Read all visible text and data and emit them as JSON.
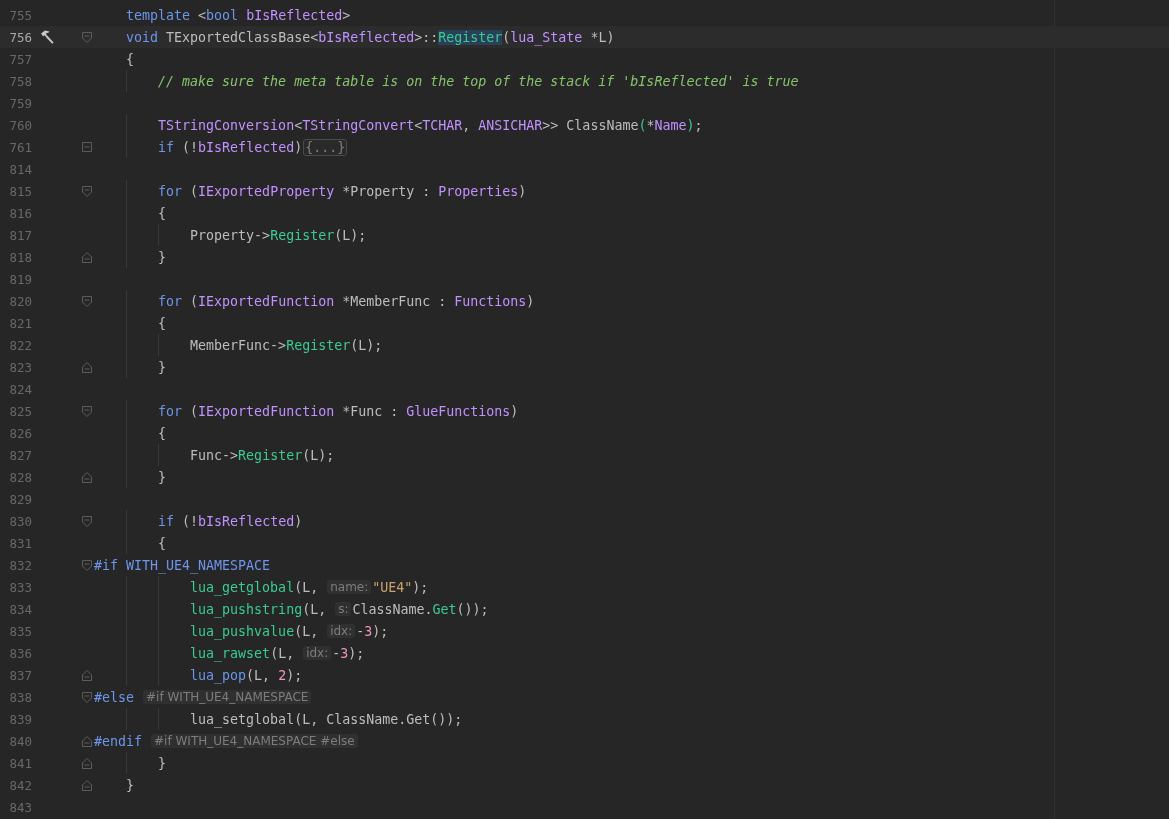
{
  "editor": {
    "lines": [
      {
        "number": "755",
        "current": false,
        "segments": [
          {
            "kind": "keyword",
            "text": "    template"
          },
          {
            "kind": "plain",
            "text": " <"
          },
          {
            "kind": "keyword",
            "text": "bool "
          },
          {
            "kind": "type",
            "text": "bIsReflected"
          },
          {
            "kind": "plain",
            "text": ">"
          }
        ]
      },
      {
        "number": "756",
        "current": true,
        "markers": [
          {
            "kind": "hammer"
          },
          {
            "kind": "fold-start"
          }
        ],
        "segments": [
          {
            "kind": "keyword",
            "text": "    void"
          },
          {
            "kind": "plain",
            "text": " TExportedClassBase<"
          },
          {
            "kind": "type",
            "text": "bIsReflected"
          },
          {
            "kind": "plain",
            "text": ">::"
          },
          {
            "kind": "usage",
            "text": "Register"
          },
          {
            "kind": "plain",
            "text": "("
          },
          {
            "kind": "type",
            "text": "lua_State"
          },
          {
            "kind": "plain",
            "text": " *L)"
          }
        ]
      },
      {
        "number": "757",
        "current": false,
        "segments": [
          {
            "kind": "plain",
            "text": "    {"
          }
        ]
      },
      {
        "number": "758",
        "current": false,
        "segments": [
          {
            "kind": "comment",
            "text": "        // make sure the meta table is on the top of the stack if 'bIsReflected' is true"
          }
        ]
      },
      {
        "number": "759",
        "current": false
      },
      {
        "number": "760",
        "current": false,
        "segments": [
          {
            "kind": "type",
            "text": "        TStringConversion"
          },
          {
            "kind": "plain",
            "text": "<"
          },
          {
            "kind": "type",
            "text": "TStringConvert"
          },
          {
            "kind": "plain",
            "text": "<"
          },
          {
            "kind": "type",
            "text": "TCHAR"
          },
          {
            "kind": "plain",
            "text": ", "
          },
          {
            "kind": "type",
            "text": "ANSICHAR"
          },
          {
            "kind": "plain",
            "text": ">> ClassName"
          },
          {
            "kind": "func",
            "text": "("
          },
          {
            "kind": "plain",
            "text": "*"
          },
          {
            "kind": "type",
            "text": "Name"
          },
          {
            "kind": "func",
            "text": ")"
          },
          {
            "kind": "plain",
            "text": ";"
          }
        ]
      },
      {
        "number": "761",
        "current": false,
        "markers": [
          {
            "kind": "collapsed"
          }
        ],
        "segments": [
          {
            "kind": "keyword",
            "text": "        if"
          },
          {
            "kind": "plain",
            "text": " (!"
          },
          {
            "kind": "type",
            "text": "bIsReflected"
          },
          {
            "kind": "plain",
            "text": ")"
          },
          {
            "kind": "folded",
            "text": "{...}"
          }
        ]
      },
      {
        "number": "814",
        "current": false
      },
      {
        "number": "815",
        "current": false,
        "markers": [
          {
            "kind": "fold-start"
          }
        ],
        "segments": [
          {
            "kind": "keyword",
            "text": "        for"
          },
          {
            "kind": "plain",
            "text": " ("
          },
          {
            "kind": "type",
            "text": "IExportedProperty"
          },
          {
            "kind": "plain",
            "text": " *Property : "
          },
          {
            "kind": "type",
            "text": "Properties"
          },
          {
            "kind": "plain",
            "text": ")"
          }
        ]
      },
      {
        "number": "816",
        "current": false,
        "segments": [
          {
            "kind": "plain",
            "text": "        {"
          }
        ]
      },
      {
        "number": "817",
        "current": false,
        "segments": [
          {
            "kind": "plain",
            "text": "            Property->"
          },
          {
            "kind": "func",
            "text": "Register"
          },
          {
            "kind": "plain",
            "text": "(L);"
          }
        ]
      },
      {
        "number": "818",
        "current": false,
        "markers": [
          {
            "kind": "fold-end"
          }
        ],
        "segments": [
          {
            "kind": "plain",
            "text": "        }"
          }
        ]
      },
      {
        "number": "819",
        "current": false
      },
      {
        "number": "820",
        "current": false,
        "markers": [
          {
            "kind": "fold-start"
          }
        ],
        "segments": [
          {
            "kind": "keyword",
            "text": "        for"
          },
          {
            "kind": "plain",
            "text": " ("
          },
          {
            "kind": "type",
            "text": "IExportedFunction"
          },
          {
            "kind": "plain",
            "text": " *MemberFunc : "
          },
          {
            "kind": "type",
            "text": "Functions"
          },
          {
            "kind": "plain",
            "text": ")"
          }
        ]
      },
      {
        "number": "821",
        "current": false,
        "segments": [
          {
            "kind": "plain",
            "text": "        {"
          }
        ]
      },
      {
        "number": "822",
        "current": false,
        "segments": [
          {
            "kind": "plain",
            "text": "            MemberFunc->"
          },
          {
            "kind": "func",
            "text": "Register"
          },
          {
            "kind": "plain",
            "text": "(L);"
          }
        ]
      },
      {
        "number": "823",
        "current": false,
        "markers": [
          {
            "kind": "fold-end"
          }
        ],
        "segments": [
          {
            "kind": "plain",
            "text": "        }"
          }
        ]
      },
      {
        "number": "824",
        "current": false
      },
      {
        "number": "825",
        "current": false,
        "markers": [
          {
            "kind": "fold-start"
          }
        ],
        "segments": [
          {
            "kind": "keyword",
            "text": "        for"
          },
          {
            "kind": "plain",
            "text": " ("
          },
          {
            "kind": "type",
            "text": "IExportedFunction"
          },
          {
            "kind": "plain",
            "text": " *Func : "
          },
          {
            "kind": "type",
            "text": "GlueFunctions"
          },
          {
            "kind": "plain",
            "text": ")"
          }
        ]
      },
      {
        "number": "826",
        "current": false,
        "segments": [
          {
            "kind": "plain",
            "text": "        {"
          }
        ]
      },
      {
        "number": "827",
        "current": false,
        "segments": [
          {
            "kind": "plain",
            "text": "            Func->"
          },
          {
            "kind": "func",
            "text": "Register"
          },
          {
            "kind": "plain",
            "text": "(L);"
          }
        ]
      },
      {
        "number": "828",
        "current": false,
        "markers": [
          {
            "kind": "fold-end"
          }
        ],
        "segments": [
          {
            "kind": "plain",
            "text": "        }"
          }
        ]
      },
      {
        "number": "829",
        "current": false
      },
      {
        "number": "830",
        "current": false,
        "markers": [
          {
            "kind": "fold-start"
          }
        ],
        "segments": [
          {
            "kind": "keyword",
            "text": "        if"
          },
          {
            "kind": "plain",
            "text": " (!"
          },
          {
            "kind": "type",
            "text": "bIsReflected"
          },
          {
            "kind": "plain",
            "text": ")"
          }
        ]
      },
      {
        "number": "831",
        "current": false,
        "segments": [
          {
            "kind": "plain",
            "text": "        {"
          }
        ]
      },
      {
        "number": "832",
        "current": false,
        "markers": [
          {
            "kind": "fold-start"
          }
        ],
        "segments": [
          {
            "kind": "macro",
            "text": "#if WITH_UE4_NAMESPACE"
          }
        ]
      },
      {
        "number": "833",
        "current": false,
        "segments": [
          {
            "kind": "func",
            "text": "            lua_getglobal"
          },
          {
            "kind": "plain",
            "text": "(L, "
          },
          {
            "kind": "hint",
            "text": "name:"
          },
          {
            "kind": "string",
            "text": "\"UE4\""
          },
          {
            "kind": "plain",
            "text": ");"
          }
        ]
      },
      {
        "number": "834",
        "current": false,
        "segments": [
          {
            "kind": "func",
            "text": "            lua_pushstring"
          },
          {
            "kind": "plain",
            "text": "(L, "
          },
          {
            "kind": "hint",
            "text": "s:"
          },
          {
            "kind": "plain",
            "text": "ClassName."
          },
          {
            "kind": "func",
            "text": "Get"
          },
          {
            "kind": "plain",
            "text": "());"
          }
        ]
      },
      {
        "number": "835",
        "current": false,
        "segments": [
          {
            "kind": "func",
            "text": "            lua_pushvalue"
          },
          {
            "kind": "plain",
            "text": "(L, "
          },
          {
            "kind": "hint",
            "text": "idx:"
          },
          {
            "kind": "plain",
            "text": "-"
          },
          {
            "kind": "number",
            "text": "3"
          },
          {
            "kind": "plain",
            "text": ");"
          }
        ]
      },
      {
        "number": "836",
        "current": false,
        "segments": [
          {
            "kind": "func",
            "text": "            lua_rawset"
          },
          {
            "kind": "plain",
            "text": "(L, "
          },
          {
            "kind": "hint",
            "text": "idx:"
          },
          {
            "kind": "plain",
            "text": "-"
          },
          {
            "kind": "number",
            "text": "3"
          },
          {
            "kind": "plain",
            "text": ");"
          }
        ]
      },
      {
        "number": "837",
        "current": false,
        "markers": [
          {
            "kind": "fold-end"
          }
        ],
        "segments": [
          {
            "kind": "macro-call",
            "text": "            lua_pop"
          },
          {
            "kind": "plain",
            "text": "(L, "
          },
          {
            "kind": "number",
            "text": "2"
          },
          {
            "kind": "plain",
            "text": ");"
          }
        ]
      },
      {
        "number": "838",
        "current": false,
        "markers": [
          {
            "kind": "fold-start"
          }
        ],
        "segments": [
          {
            "kind": "macro",
            "text": "#else "
          },
          {
            "kind": "hint",
            "text": "#if WITH_UE4_NAMESPACE"
          }
        ]
      },
      {
        "number": "839",
        "current": false,
        "segments": [
          {
            "kind": "plain",
            "text": "            lua_setglobal(L, ClassName.Get());"
          }
        ]
      },
      {
        "number": "840",
        "current": false,
        "markers": [
          {
            "kind": "fold-end"
          }
        ],
        "segments": [
          {
            "kind": "macro",
            "text": "#endif "
          },
          {
            "kind": "hint",
            "text": "#if WITH_UE4_NAMESPACE #else"
          }
        ]
      },
      {
        "number": "841",
        "current": false,
        "markers": [
          {
            "kind": "fold-end"
          }
        ],
        "segments": [
          {
            "kind": "plain",
            "text": "        }"
          }
        ]
      },
      {
        "number": "842",
        "current": false,
        "markers": [
          {
            "kind": "fold-end"
          }
        ],
        "segments": [
          {
            "kind": "plain",
            "text": "    }"
          }
        ]
      },
      {
        "number": "843",
        "current": false
      }
    ]
  }
}
